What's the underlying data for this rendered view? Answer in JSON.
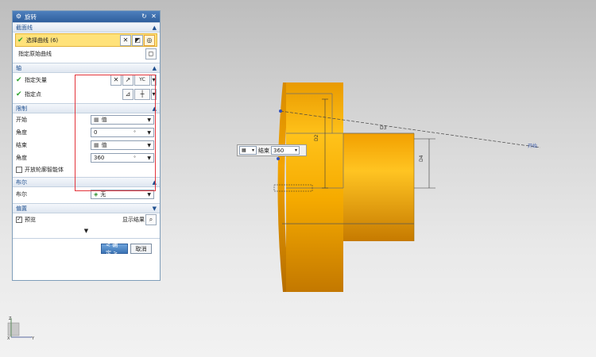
{
  "dialog": {
    "title": "旋转",
    "reset_icon": "refresh-icon",
    "close_icon": "close-icon",
    "sections": {
      "section_curve": {
        "header": "截面线",
        "select_curve": "选择曲线 (6)",
        "specify_origin_curve": "指定原始曲线"
      },
      "axis": {
        "header": "轴",
        "specify_vector": "指定矢量",
        "specify_point": "指定点",
        "vector_label": "YC"
      },
      "limits": {
        "header": "限制",
        "start_label": "开始",
        "start_option": "值",
        "start_angle_label": "角度",
        "start_angle_value": "0",
        "end_label": "结束",
        "end_option": "值",
        "end_angle_label": "角度",
        "end_angle_value": "360",
        "unit": "°",
        "open_profile_label": "开放轮廓智能体"
      },
      "boolean": {
        "header": "布尔",
        "label": "布尔",
        "value": "无"
      },
      "settings": {
        "header": "偏置",
        "preview_label": "预览",
        "show_result": "显示结果"
      }
    },
    "buttons": {
      "ok": "< 确定 >",
      "cancel": "取消"
    }
  },
  "onscreen_input": {
    "label": "结束",
    "value": "360"
  },
  "viewport": {
    "annotation_label": "开始",
    "part_color": "#f5a800"
  },
  "triad": {
    "z": "Z",
    "y": "Y",
    "x": "X"
  },
  "colors": {
    "accent": "#2f5f9d",
    "highlight": "#ffe27a",
    "red_box": "#e3343b",
    "check": "#2da42d"
  }
}
